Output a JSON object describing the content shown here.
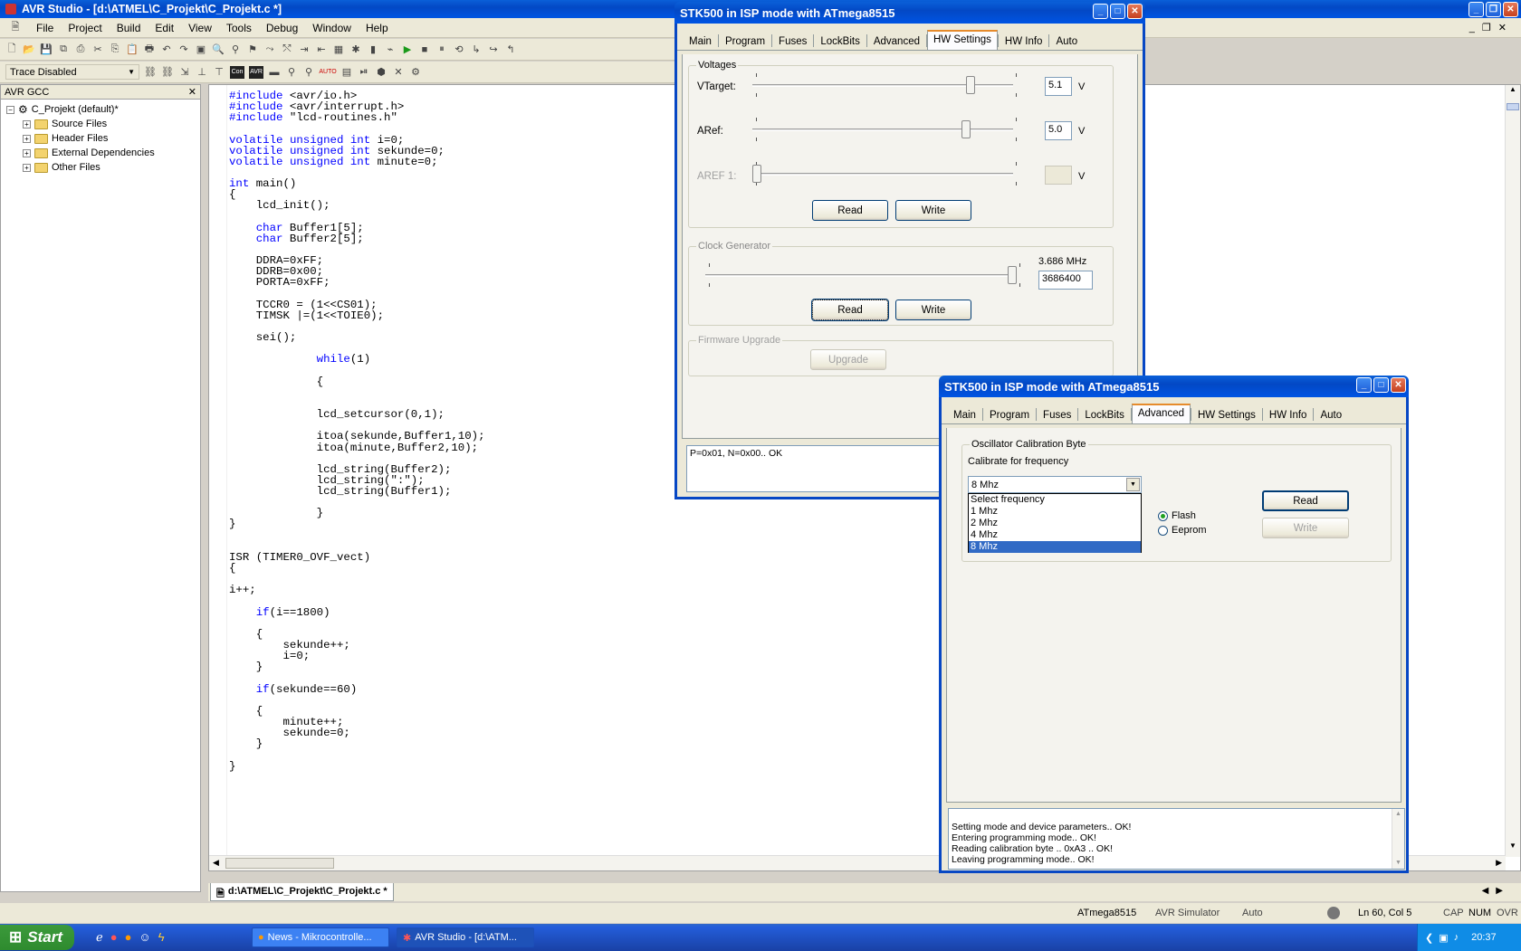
{
  "app": {
    "title": "AVR Studio - [d:\\ATMEL\\C_Projekt\\C_Projekt.c *]",
    "menu": [
      "File",
      "Project",
      "Build",
      "Edit",
      "View",
      "Tools",
      "Debug",
      "Window",
      "Help"
    ],
    "trace_select": "Trace Disabled"
  },
  "tree": {
    "header": "AVR GCC",
    "root": "C_Projekt (default)*",
    "items": [
      "Source Files",
      "Header Files",
      "External Dependencies",
      "Other Files"
    ]
  },
  "editor": {
    "tab_label": "d:\\ATMEL\\C_Projekt\\C_Projekt.c *",
    "lines": [
      "#include <avr/io.h>",
      "#include <avr/interrupt.h>",
      "#include \"lcd-routines.h\"",
      "",
      "volatile unsigned int i=0;",
      "volatile unsigned int sekunde=0;",
      "volatile unsigned int minute=0;",
      "",
      "int main()",
      "{",
      "    lcd_init();",
      "",
      "    char Buffer1[5];",
      "    char Buffer2[5];",
      "",
      "    DDRA=0xFF;",
      "    DDRB=0x00;",
      "    PORTA=0xFF;",
      "",
      "    TCCR0 = (1<<CS01);",
      "    TIMSK |=(1<<TOIE0);",
      "",
      "    sei();",
      "",
      "             while(1)",
      "",
      "             {",
      "",
      "",
      "             lcd_setcursor(0,1);",
      "",
      "             itoa(sekunde,Buffer1,10);",
      "             itoa(minute,Buffer2,10);",
      "",
      "             lcd_string(Buffer2);",
      "             lcd_string(\":\");",
      "             lcd_string(Buffer1);",
      "",
      "             }",
      "}",
      "",
      "",
      "ISR (TIMER0_OVF_vect)",
      "{",
      "",
      "i++;",
      "",
      "    if(i==1800)",
      "",
      "    {",
      "        sekunde++;",
      "        i=0;",
      "    }",
      "",
      "    if(sekunde==60)",
      "",
      "    {",
      "        minute++;",
      "        sekunde=0;",
      "    }",
      "",
      "}"
    ]
  },
  "status": {
    "device": "ATmega8515",
    "platform": "AVR Simulator",
    "mode": "Auto",
    "position": "Ln 60, Col 5",
    "cap": "CAP",
    "num": "NUM",
    "ovr": "OVR"
  },
  "taskbar": {
    "start": "Start",
    "tasks": [
      "News - Mikrocontrolle...",
      "AVR Studio - [d:\\ATM..."
    ],
    "clock": "20:37"
  },
  "dialog1": {
    "title": "STK500 in ISP mode with ATmega8515",
    "tabs": [
      "Main",
      "Program",
      "Fuses",
      "LockBits",
      "Advanced",
      "HW Settings",
      "HW Info",
      "Auto"
    ],
    "selected_tab": "HW Settings",
    "voltages_label": "Voltages",
    "vtarget_label": "VTarget:",
    "vtarget_value": "5.1",
    "aref_label": "ARef:",
    "aref_value": "5.0",
    "aref1_label": "AREF 1:",
    "aref1_value": "",
    "unit_v": "V",
    "vtarget_level": 0.85,
    "aref_level": 0.83,
    "aref1_level": 0.0,
    "read": "Read",
    "write": "Write",
    "clock_label": "Clock Generator",
    "clock_freq": "3.686 MHz",
    "clock_value": "3686400",
    "clock_level": 1.0,
    "firmware_label": "Firmware Upgrade",
    "upgrade": "Upgrade",
    "log": "P=0x01, N=0x00.. OK"
  },
  "dialog2": {
    "title": "STK500 in ISP mode with ATmega8515",
    "tabs": [
      "Main",
      "Program",
      "Fuses",
      "LockBits",
      "Advanced",
      "HW Settings",
      "HW Info",
      "Auto"
    ],
    "selected_tab": "Advanced",
    "osc_label": "Oscillator Calibration Byte",
    "calibrate_label": "Calibrate for frequency",
    "select_value": "8 Mhz",
    "options": [
      "Select frequency",
      "1 Mhz",
      "2 Mhz",
      "4 Mhz",
      "8 Mhz"
    ],
    "highlighted_option": "8 Mhz",
    "flash": "Flash",
    "eeprom": "Eeprom",
    "read": "Read",
    "write": "Write",
    "log": [
      "Setting mode and device parameters.. OK!",
      "Entering programming mode.. OK!",
      "Reading calibration byte .. 0xA3 .. OK!",
      "Leaving programming mode.. OK!"
    ]
  },
  "colors": {
    "titlebar": "#0054e3",
    "keyword": "#0000ff",
    "highlight": "#316ac5"
  }
}
